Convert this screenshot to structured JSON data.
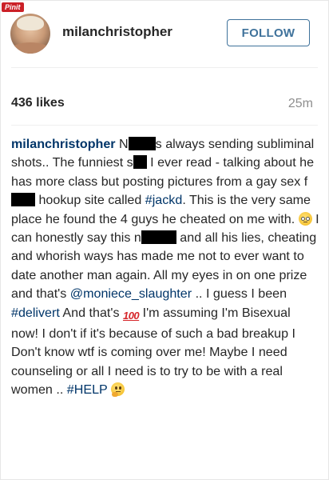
{
  "watermark": {
    "label": "Pinit"
  },
  "header": {
    "username": "milanchristopher",
    "follow_label": "FOLLOW"
  },
  "stats": {
    "likes": "436 likes",
    "time_ago": "25m"
  },
  "caption": {
    "author": "milanchristopher",
    "seg1": " N",
    "seg2": "s always sending subliminal shots.. The funniest s",
    "seg3": " I ever read - talking about he has more class but posting pictures from a gay sex f",
    "seg4": " hookup site called ",
    "hashtag_jackd": "#jackd",
    "seg5": ". This is the very same place he found the 4 guys he cheated on me with. ",
    "seg6": " I can honestly say this n",
    "seg7": " and all his lies, cheating and whorish ways has made me not to ever want to date another man again. All my eyes in on one prize and that's ",
    "mention": "@moniece_slaughter",
    "seg8": " .. I guess I been ",
    "hashtag_delivert": "#delivert",
    "seg9": " And that's ",
    "emoji_100": "100",
    "seg10": " I'm assuming I'm Bisexual now! I don't if it's because of such a bad breakup I Don't know wtf is coming over me! Maybe I need counseling or all I need is to try to be with a real women .. ",
    "hashtag_help": "#HELP",
    "seg11": " "
  },
  "icons": {
    "rolling_eyes": "rolling-eyes-emoji",
    "hundred": "hundred-points-emoji",
    "thinking": "thinking-face-emoji"
  },
  "colors": {
    "follow_blue": "#3f729b",
    "link_blue": "#003569",
    "pinit_red": "#cb2027"
  }
}
